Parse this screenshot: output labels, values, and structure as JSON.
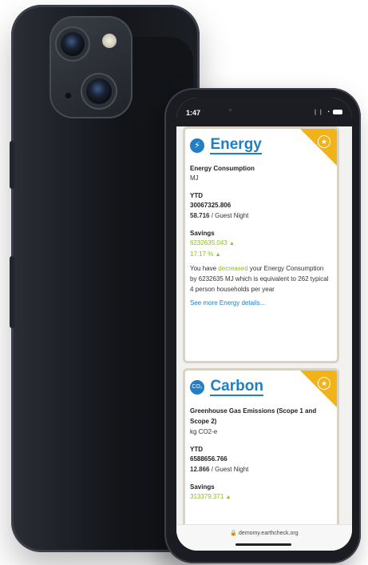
{
  "status_bar": {
    "time": "1:47",
    "icons": "❘❘ ◔"
  },
  "cards": {
    "energy": {
      "title": "Energy",
      "icon": "lightning-bolt-icon",
      "metric_label": "Energy Consumption",
      "unit": "MJ",
      "ytd_label": "YTD",
      "ytd_total": "30067325.806",
      "per_guest_value": "58.716",
      "per_guest_suffix": " / Guest Night",
      "savings_label": "Savings",
      "savings_value": "6232635.043",
      "savings_percent": "17.17 %",
      "desc_prefix": "You have ",
      "desc_highlight": "decreased",
      "desc_suffix": " your Energy Consumption by 6232635 MJ which is equivalent to 262 typical 4 person households per year",
      "link": "See more Energy details..."
    },
    "carbon": {
      "title": "Carbon",
      "icon": "co2-icon",
      "icon_text": "CO₂",
      "metric_label": "Greenhouse Gas Emissions (Scope 1 and Scope 2)",
      "unit": "kg CO2-e",
      "ytd_label": "YTD",
      "ytd_total": "6588656.766",
      "per_guest_value": "12.866",
      "per_guest_suffix": " / Guest Night",
      "savings_label": "Savings",
      "savings_value": "313379.371"
    }
  },
  "url_bar": {
    "url": "🔒 demomy.earthcheck.org"
  },
  "colors": {
    "accent_blue": "#1f7ec4",
    "ribbon_gold": "#f2b21a",
    "savings_green": "#8cbf1f"
  }
}
